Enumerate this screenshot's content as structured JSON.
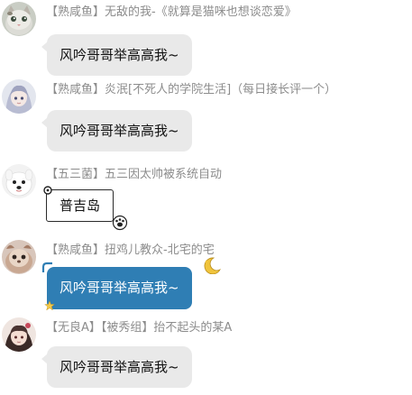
{
  "messages": [
    {
      "sender": "【熟咸鱼】无敌的我-《就算是猫咪也想谈恋爱》",
      "text": "风吟哥哥举高高我~",
      "avatar_icon": "cat-avatar-icon",
      "bubble_style": "gray"
    },
    {
      "sender": "【熟咸鱼】炎泯[不死人的学院生活]（每日接长评一个）",
      "text": "风吟哥哥举高高我~",
      "avatar_icon": "anime-girl-avatar-icon",
      "bubble_style": "gray"
    },
    {
      "sender": "【五三菌】五三因太帅被系统自动",
      "text": "普吉岛",
      "avatar_icon": "white-dog-avatar-icon",
      "bubble_style": "framed"
    },
    {
      "sender": "【熟咸鱼】扭鸡儿教众-北宅的宅",
      "text": "风吟哥哥举高高我~",
      "avatar_icon": "pet-avatar-icon",
      "bubble_style": "blue"
    },
    {
      "sender": "【无良A】【被秀组】抬不起头的某A",
      "text": "风吟哥哥举高高我~",
      "avatar_icon": "anime-boy-avatar-icon",
      "bubble_style": "gray"
    }
  ],
  "colors": {
    "sender_text": "#8c8c8c",
    "bubble_gray": "#e9e9e9",
    "bubble_blue": "#2f7eb4"
  }
}
